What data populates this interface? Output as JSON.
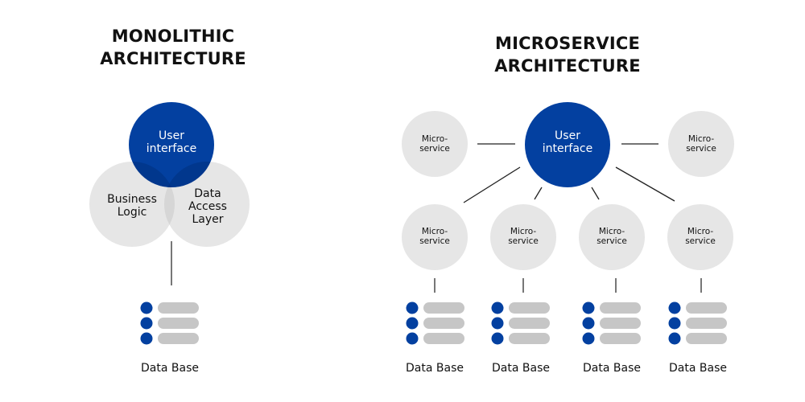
{
  "colors": {
    "primary_blue": "#0340A0",
    "light_gray_circle": "#E6E6E6",
    "overlap_gray": "#D6D6D6",
    "db_bar_gray": "#C6C6C6",
    "connector": "#222222",
    "db_connector": "#777777"
  },
  "monolithic": {
    "title_line1": "MONOLITHIC",
    "title_line2": "ARCHITECTURE",
    "user_interface": {
      "line1": "User",
      "line2": "interface"
    },
    "business_logic": {
      "line1": "Business",
      "line2": "Logic"
    },
    "data_access_layer": {
      "line1": "Data",
      "line2": "Access",
      "line3": "Layer"
    },
    "database": {
      "icon": "database-icon",
      "label": "Data Base"
    }
  },
  "microservice": {
    "title_line1": "MICROSERVICE",
    "title_line2": "ARCHITECTURE",
    "user_interface": {
      "line1": "User",
      "line2": "interface"
    },
    "services": [
      {
        "line1": "Micro-",
        "line2": "service"
      },
      {
        "line1": "Micro-",
        "line2": "service"
      },
      {
        "line1": "Micro-",
        "line2": "service"
      },
      {
        "line1": "Micro-",
        "line2": "service"
      },
      {
        "line1": "Micro-",
        "line2": "service"
      },
      {
        "line1": "Micro-",
        "line2": "service"
      }
    ],
    "databases": [
      {
        "icon": "database-icon",
        "label": "Data Base"
      },
      {
        "icon": "database-icon",
        "label": "Data Base"
      },
      {
        "icon": "database-icon",
        "label": "Data Base"
      },
      {
        "icon": "database-icon",
        "label": "Data Base"
      }
    ]
  }
}
